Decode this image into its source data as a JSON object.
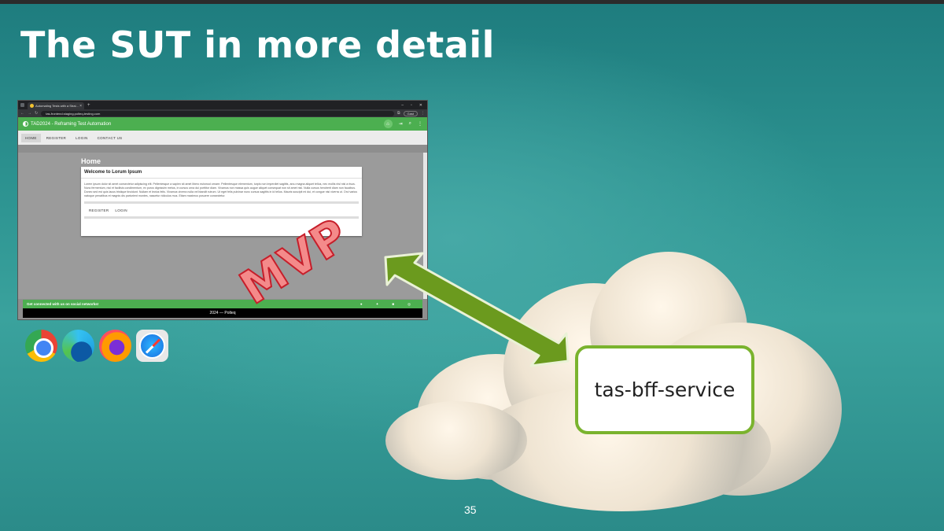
{
  "slide": {
    "title": "The SUT in more detail",
    "page_number": "35",
    "stamp": "MVP",
    "service_label": "tas-bff-service"
  },
  "browser": {
    "tab_title": "Automating Tests with a Strai...",
    "tab_close": "×",
    "new_tab": "+",
    "url": "tas-frontend.staging.polteq-testing.com",
    "guest_label": "Gast",
    "app_title": "TAD2024 - Reframing Test Automation",
    "menu": [
      "HOME",
      "REGISTER",
      "LOGIN",
      "CONTACT US"
    ],
    "page_heading": "Home",
    "card": {
      "title": "Welcome to Lorum Ipsum",
      "body": "Lorem ipsum dolor sit amet consectetur adipiscing elit. Pellentesque a sapien sit amet libero euismod ornare. Pellentesque elementum, turpis non imperdiet sagittis, arcu magna aliquet tellus, nec mollis nisl nisl a risus. Nunc fermentum, nisi et facilisis condimentum, ex purus dignissim metus, in cursus urna dui porttitor diam. Vivamus non massa quis augue aliquet consequat non sit amet nisl. Nulla cursus hendrerit diam non faucibus. Donec sed est quis lacus tristique tincidunt. Nullam et lectus felis. Vivamus viverra nulla vel blandit rutrum. Ut eget felis pulvinar nunc cursus sagittis in id tellus. Mauris suscipit mi dui, et congue nisi viverra ut. Orci varius natoque penatibus et magnis dis parturient montes, nascetur ridiculus mus. Etiam maximus posuere consectetur.",
      "buttons": [
        "REGISTER",
        "LOGIN"
      ]
    },
    "footer_social_text": "Get connected with us on social networks!",
    "social_icons": [
      "github-icon",
      "twitter-icon",
      "linkedin-icon",
      "instagram-icon"
    ],
    "footer_copyright": "2024 — Polteq"
  },
  "browser_logos": [
    "chrome-logo",
    "edge-logo",
    "firefox-logo",
    "safari-logo"
  ],
  "colors": {
    "app_green": "#4caf50",
    "service_border": "#7ab32e",
    "arrow_green": "#6b9a1e",
    "stamp_red": "#c61e2a"
  }
}
